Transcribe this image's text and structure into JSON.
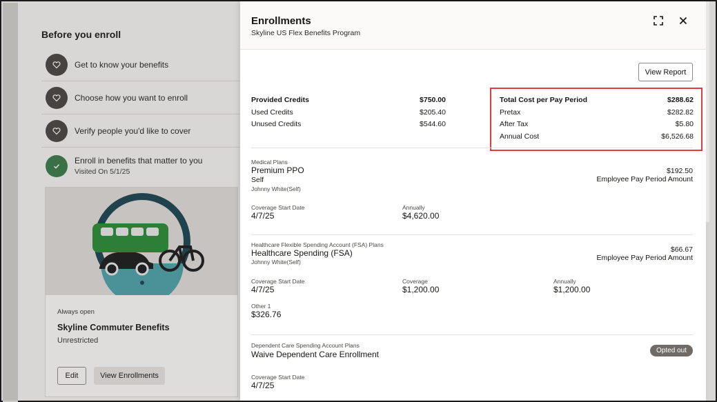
{
  "background": {
    "title": "Before you enroll",
    "steps": [
      {
        "label": "Get to know your benefits"
      },
      {
        "label": "Choose how you want to enroll"
      },
      {
        "label": "Verify people you'd like to cover"
      },
      {
        "label": "Enroll in benefits that matter to you",
        "sub": "Visited On 5/1/25"
      }
    ],
    "card": {
      "availability": "Always open",
      "title": "Skyline Commuter Benefits",
      "subtitle": "Unrestricted",
      "edit_label": "Edit",
      "view_label": "View Enrollments"
    }
  },
  "drawer": {
    "title": "Enrollments",
    "subtitle": "Skyline US Flex Benefits Program",
    "view_report_label": "View Report",
    "credits": [
      {
        "label": "Provided Credits",
        "value": "$750.00"
      },
      {
        "label": "Used Credits",
        "value": "$205.40"
      },
      {
        "label": "Unused Credits",
        "value": "$544.60"
      }
    ],
    "cost": [
      {
        "label": "Total Cost per Pay Period",
        "value": "$288.62"
      },
      {
        "label": "Pretax",
        "value": "$282.82"
      },
      {
        "label": "After Tax",
        "value": "$5.80"
      },
      {
        "label": "Annual Cost",
        "value": "$6,526.68"
      }
    ],
    "medical": {
      "category": "Medical Plans",
      "plan": "Premium PPO",
      "coverage": "Self",
      "person": "Johnny White(Self)",
      "amount": "$192.50",
      "amount_label": "Employee Pay Period Amount",
      "start_label": "Coverage Start Date",
      "start_value": "4/7/25",
      "annual_label": "Annually",
      "annual_value": "$4,620.00"
    },
    "fsa": {
      "category": "Healthcare Flexible Spending Account (FSA) Plans",
      "plan": "Healthcare Spending (FSA)",
      "person": "Johnny White(Self)",
      "amount": "$66.67",
      "amount_label": "Employee Pay Period Amount",
      "start_label": "Coverage Start Date",
      "start_value": "4/7/25",
      "coverage_label": "Coverage",
      "coverage_value": "$1,200.00",
      "annual_label": "Annually",
      "annual_value": "$1,200.00",
      "other_label": "Other 1",
      "other_value": "$326.76"
    },
    "dependent": {
      "category": "Dependent Care Spending Account Plans",
      "plan": "Waive Dependent Care Enrollment",
      "badge": "Opted out",
      "start_label": "Coverage Start Date",
      "start_value": "4/7/25"
    }
  }
}
